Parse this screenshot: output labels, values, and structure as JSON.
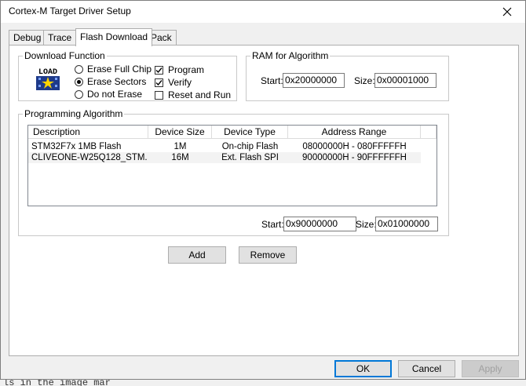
{
  "window": {
    "title": "Cortex-M Target Driver Setup"
  },
  "tabs": [
    {
      "label": "Debug",
      "active": false
    },
    {
      "label": "Trace",
      "active": false
    },
    {
      "label": "Flash Download",
      "active": true
    },
    {
      "label": "Pack",
      "active": false
    }
  ],
  "download_function": {
    "legend": "Download Function",
    "icon_text": "LOAD",
    "erase_options": [
      {
        "label": "Erase Full Chip",
        "selected": false
      },
      {
        "label": "Erase Sectors",
        "selected": true
      },
      {
        "label": "Do not Erase",
        "selected": false
      }
    ],
    "checks": [
      {
        "label": "Program",
        "checked": true
      },
      {
        "label": "Verify",
        "checked": true
      },
      {
        "label": "Reset and Run",
        "checked": false
      }
    ]
  },
  "ram_for_algorithm": {
    "legend": "RAM for Algorithm",
    "start_label": "Start:",
    "start_value": "0x20000000",
    "size_label": "Size:",
    "size_value": "0x00001000"
  },
  "programming_algorithm": {
    "legend": "Programming Algorithm",
    "columns": [
      "Description",
      "Device Size",
      "Device Type",
      "Address Range"
    ],
    "rows": [
      [
        "STM32F7x 1MB Flash",
        "1M",
        "On-chip Flash",
        "08000000H - 080FFFFFH"
      ],
      [
        "CLIVEONE-W25Q128_STM...",
        "16M",
        "Ext. Flash SPI",
        "90000000H - 90FFFFFFH"
      ]
    ],
    "start_label": "Start:",
    "start_value": "0x90000000",
    "size_label": "Size:",
    "size_value": "0x01000000"
  },
  "buttons": {
    "add": "Add",
    "remove": "Remove",
    "ok": "OK",
    "cancel": "Cancel",
    "apply": "Apply"
  },
  "background_text": "ls in the image mar"
}
